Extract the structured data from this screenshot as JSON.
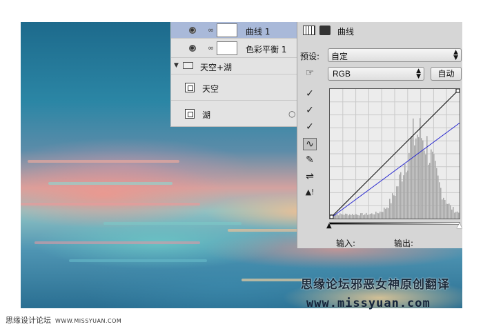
{
  "layers": {
    "items": [
      {
        "name": "曲线 1",
        "selected": true
      },
      {
        "name": "色彩平衡 1",
        "selected": false
      },
      {
        "name": "天空+湖",
        "group": true
      },
      {
        "name": "天空",
        "selected": false
      },
      {
        "name": "湖",
        "selected": false
      }
    ]
  },
  "properties": {
    "panel_title": "曲线",
    "preset_label": "预设:",
    "preset_value": "自定",
    "channel_value": "RGB",
    "auto_button": "自动",
    "input_label": "输入:",
    "output_label": "输出:"
  },
  "curve": {
    "channel_curve_color": "#2a2ad0",
    "rgb_line_color": "#000000",
    "blue_channel_points": [
      [
        0,
        0
      ],
      [
        255,
        188
      ]
    ],
    "rgb_points": [
      [
        0,
        0
      ],
      [
        255,
        255
      ]
    ]
  },
  "icons": [
    "curves-adjustment-icon",
    "mask-icon",
    "hand-adjust-icon",
    "black-eyedropper-icon",
    "gray-eyedropper-icon",
    "white-eyedropper-icon",
    "curve-tool-icon",
    "pencil-icon",
    "smooth-icon",
    "clipping-warning-icon",
    "eye-icon",
    "chain-icon",
    "folder-icon",
    "smart-object-icon",
    "link-icon"
  ],
  "watermark": {
    "text": "思缘论坛邪恶女神原创翻译",
    "url": "www.missyuan.com"
  },
  "caption": {
    "text": "思缘设计论坛",
    "url": "WWW.MISSYUAN.COM"
  }
}
